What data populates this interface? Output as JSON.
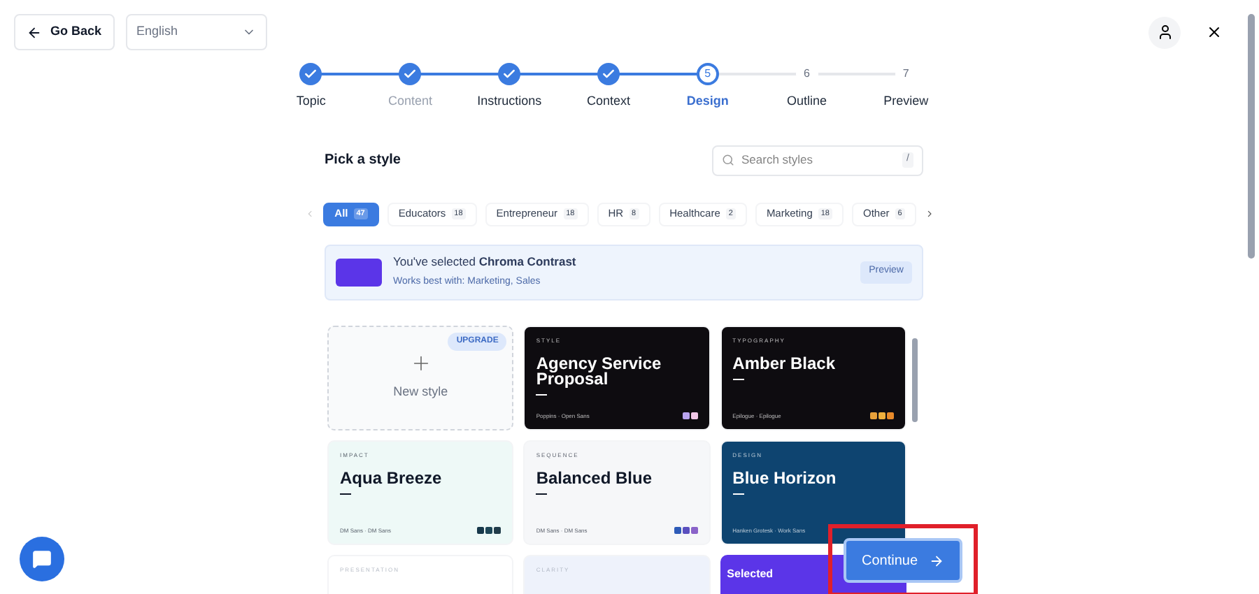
{
  "top_bar": {
    "back_label": "Go Back",
    "language": "English"
  },
  "steps": [
    {
      "label": "Topic",
      "done": true,
      "selected": false,
      "disabled": false
    },
    {
      "label": "Content",
      "done": true,
      "selected": false,
      "disabled": true
    },
    {
      "label": "Instructions",
      "done": true,
      "selected": false,
      "disabled": false
    },
    {
      "label": "Context",
      "done": true,
      "selected": false,
      "disabled": false
    },
    {
      "label": "Design",
      "number": "5",
      "done": false,
      "selected": true,
      "disabled": false
    },
    {
      "label": "Outline",
      "number": "6",
      "done": false,
      "selected": false,
      "disabled": false
    },
    {
      "label": "Preview",
      "number": "7",
      "done": false,
      "selected": false,
      "disabled": false
    }
  ],
  "heading": "Pick a style",
  "search": {
    "placeholder": "Search styles",
    "shortcut": "/"
  },
  "filters": [
    {
      "label": "All",
      "count": "47",
      "selected": true
    },
    {
      "label": "Educators",
      "count": "18",
      "selected": false
    },
    {
      "label": "Entrepreneur",
      "count": "18",
      "selected": false
    },
    {
      "label": "HR",
      "count": "8",
      "selected": false
    },
    {
      "label": "Healthcare",
      "count": "2",
      "selected": false
    },
    {
      "label": "Marketing",
      "count": "18",
      "selected": false
    },
    {
      "label": "Other",
      "count": "6",
      "selected": false
    }
  ],
  "banner": {
    "title": "You've selected **Chroma Contrast**",
    "subtitle": "Works best with: Marketing, Sales",
    "button": "Preview"
  },
  "cards": [
    {
      "kind": "new",
      "label": "New style",
      "badge": "UPGRADE"
    },
    {
      "kind": "dark",
      "category": "STYLE",
      "title": "Agency Service Proposal",
      "fonts": "Poppins · Open Sans",
      "swatches": [
        {
          "color": "#b9a4ef"
        },
        {
          "color": "#f0c6e6"
        }
      ]
    },
    {
      "kind": "dark",
      "category": "TYPOGRAPHY",
      "title": "Amber Black",
      "fonts": "Epilogue · Epilogue",
      "swatches": [
        {
          "color": "#e8a13a"
        },
        {
          "color": "#f0b03d"
        },
        {
          "color": "#e88a2a"
        }
      ]
    },
    {
      "kind": "mint",
      "category": "IMPACT",
      "title": "Aqua Breeze",
      "fonts": "DM Sans · DM Sans",
      "swatches": [
        {
          "color": "#16384a"
        },
        {
          "color": "#1d4657"
        },
        {
          "color": "#213c4a"
        }
      ]
    },
    {
      "kind": "pale",
      "category": "SEQUENCE",
      "title": "Balanced Blue",
      "fonts": "DM Sans · DM Sans",
      "swatches": [
        {
          "color": "#2d5bb8"
        },
        {
          "color": "#5a4fbf"
        },
        {
          "color": "#8a63c9"
        }
      ]
    },
    {
      "kind": "navy",
      "category": "DESIGN",
      "title": "Blue Horizon",
      "fonts": "Hanken Grotesk · Work Sans"
    },
    {
      "kind": "white",
      "category": "PRESENTATION"
    },
    {
      "kind": "lavender",
      "category": "CLARITY"
    },
    {
      "kind": "selected",
      "badge": "Selected"
    }
  ],
  "continue_label": "Continue"
}
